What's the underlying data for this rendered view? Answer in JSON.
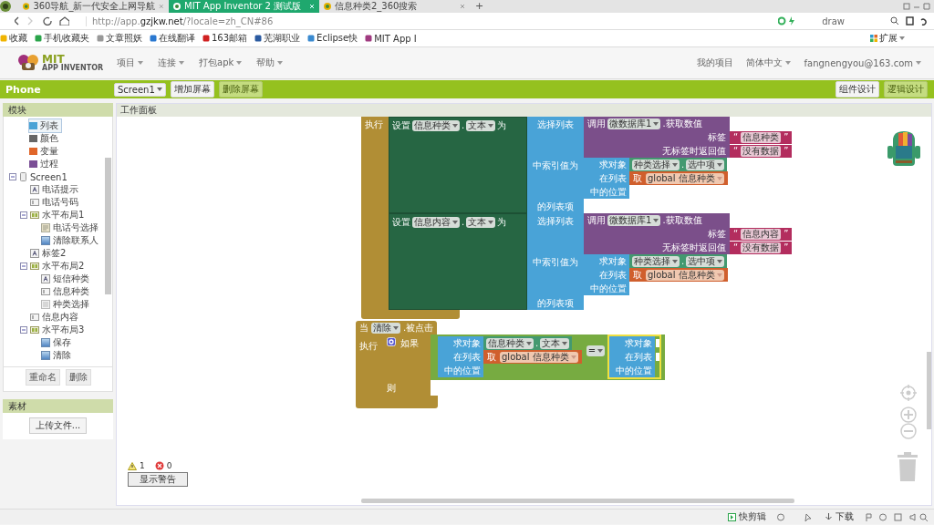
{
  "browser": {
    "tabs": [
      {
        "label": "360导航_新一代安全上网导航",
        "selected": false
      },
      {
        "label": "MIT App Inventor 2 测试版",
        "selected": true
      },
      {
        "label": "信息种类2_360搜索",
        "selected": false
      }
    ],
    "new_tab": "+",
    "url_host_prefix": "http://app.",
    "url_host": "gzjkw.net",
    "url_rest": "/?locale=zh_CN#86",
    "url_extra": "draw",
    "bookmarks": [
      "收藏",
      "手机收藏夹",
      "文章照妖",
      "在线翻译",
      "163邮箱",
      "芜湖职业",
      "Eclipse快",
      "MIT App I"
    ],
    "extensions": "扩展"
  },
  "app": {
    "logo_title": "MIT",
    "logo_subtitle": "APP INVENTOR",
    "menu": [
      "项目",
      "连接",
      "打包apk",
      "帮助"
    ],
    "account": [
      "我的项目",
      "简体中文",
      "fangnengyou@163.com"
    ]
  },
  "toolbar": {
    "title": "Phone",
    "screen": "Screen1",
    "buttons": [
      {
        "label": "增加屏幕",
        "disabled": false
      },
      {
        "label": "删除屏幕",
        "disabled": true
      }
    ],
    "views": [
      {
        "label": "组件设计",
        "selected": false
      },
      {
        "label": "逻辑设计",
        "selected": true
      }
    ]
  },
  "blocks_panel": {
    "title": "模块",
    "builtin": [
      {
        "label": "列表",
        "color": "#4aa3d6",
        "selected": true
      },
      {
        "label": "颜色",
        "color": "#666666",
        "selected": false
      },
      {
        "label": "变量",
        "color": "#e0662a",
        "selected": false
      },
      {
        "label": "过程",
        "color": "#7b4f96",
        "selected": false
      }
    ],
    "tree": [
      {
        "label": "Screen1",
        "kind": "screen",
        "expanded": true,
        "children": [
          {
            "label": "电话提示",
            "kind": "label"
          },
          {
            "label": "电话号码",
            "kind": "textbox"
          },
          {
            "label": "水平布局1",
            "kind": "arrangement",
            "expanded": true,
            "children": [
              {
                "label": "电话号选择",
                "kind": "picker"
              },
              {
                "label": "清除联系人",
                "kind": "button"
              }
            ]
          },
          {
            "label": "标签2",
            "kind": "label"
          },
          {
            "label": "水平布局2",
            "kind": "arrangement",
            "expanded": true,
            "children": [
              {
                "label": "短信种类",
                "kind": "label"
              },
              {
                "label": "信息种类",
                "kind": "textbox"
              },
              {
                "label": "种类选择",
                "kind": "listpicker"
              }
            ]
          },
          {
            "label": "信息内容",
            "kind": "textbox"
          },
          {
            "label": "水平布局3",
            "kind": "arrangement",
            "expanded": true,
            "children": [
              {
                "label": "保存",
                "kind": "button"
              },
              {
                "label": "清除",
                "kind": "button"
              }
            ]
          }
        ]
      }
    ],
    "buttons": [
      "重命名",
      "删除"
    ]
  },
  "media_panel": {
    "title": "素材",
    "upload": "上传文件..."
  },
  "workspace": {
    "title": "工作面板",
    "event_top": {
      "do": "执行",
      "statements": [
        {
          "set": "设置",
          "component": "信息种类",
          "dot": ".",
          "property": "文本",
          "to": "为",
          "select": {
            "title": "选择列表",
            "call": {
              "call": "调用",
              "db": "微数据库1",
              "method": ".获取数值",
              "tag_label": "标签",
              "tag": {
                "open": "“",
                "text": "信息种类",
                "close": "”"
              },
              "default_label": "无标签时返回值",
              "default": {
                "open": "“",
                "text": "没有数据",
                "close": "”"
              }
            },
            "index_label": "中索引值为",
            "index": {
              "find": "求对象",
              "object": {
                "component": "种类选择",
                "dot": ".",
                "property": "选中项"
              },
              "in_list": "在列表",
              "list": {
                "get": "取",
                "var": "global 信息种类"
              },
              "position": "中的位置",
              "selected": false
            },
            "item": "的列表项"
          }
        },
        {
          "set": "设置",
          "component": "信息内容",
          "dot": ".",
          "property": "文本",
          "to": "为",
          "select": {
            "title": "选择列表",
            "call": {
              "call": "调用",
              "db": "微数据库1",
              "method": ".获取数值",
              "tag_label": "标签",
              "tag": {
                "open": "“",
                "text": "信息内容",
                "close": "”"
              },
              "default_label": "无标签时返回值",
              "default": {
                "open": "“",
                "text": "没有数据",
                "close": "”"
              }
            },
            "index_label": "中索引值为",
            "index": {
              "find": "求对象",
              "object": {
                "component": "种类选择",
                "dot": ".",
                "property": "选中项"
              },
              "in_list": "在列表",
              "list": {
                "get": "取",
                "var": "global 信息种类"
              },
              "position": "中的位置",
              "selected": false
            },
            "item": "的列表项"
          }
        }
      ]
    },
    "event_click": {
      "when": "当",
      "component": "清除",
      "event": ".被点击",
      "do": "执行",
      "if": {
        "label": "如果",
        "then": "则",
        "condition": {
          "left": {
            "find": "求对象",
            "object": {
              "component": "信息种类",
              "dot": ".",
              "property": "文本"
            },
            "in_list": "在列表",
            "list": {
              "get": "取",
              "var": "global 信息种类"
            },
            "position": "中的位置",
            "selected": false
          },
          "op": "=",
          "right": {
            "find": "求对象",
            "in_list": "在列表",
            "position": "中的位置",
            "selected": true
          }
        }
      }
    },
    "warnings": {
      "warning_count": "1",
      "error_count": "0",
      "button": "显示警告"
    }
  },
  "status_bar": {
    "items": [
      "快剪辑",
      "下载"
    ]
  }
}
